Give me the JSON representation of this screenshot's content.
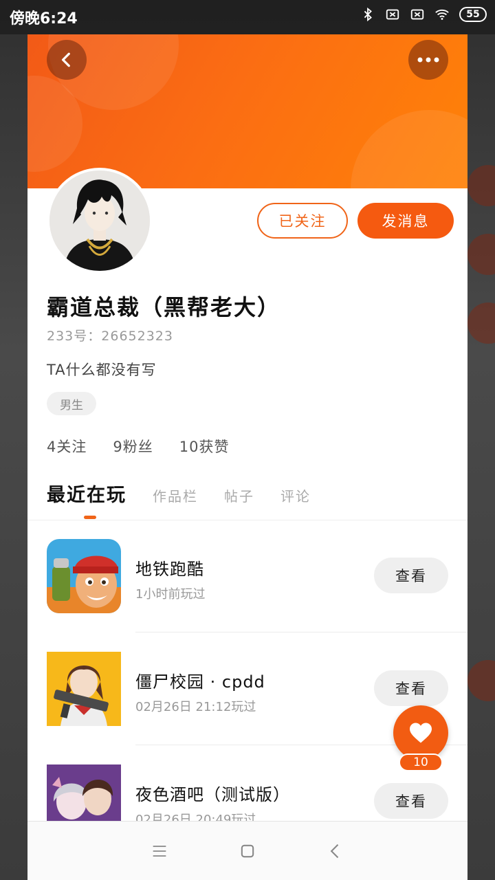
{
  "status_bar": {
    "time": "傍晚6:24",
    "battery": "55"
  },
  "header": {
    "back_icon": "chevron-left-icon",
    "more_icon": "ellipsis-icon"
  },
  "profile": {
    "username": "霸道总裁（黑帮老大）",
    "uid": "233号：26652323",
    "bio": "TA什么都没有写",
    "gender": "男生",
    "following": "4关注",
    "followers": "9粉丝",
    "likes": "10获赞"
  },
  "actions": {
    "followed_label": "已关注",
    "message_label": "发消息"
  },
  "tabs": [
    {
      "label": "最近在玩"
    },
    {
      "label": "作品栏"
    },
    {
      "label": "帖子"
    },
    {
      "label": "评论"
    }
  ],
  "games": [
    {
      "title": "地铁跑酷",
      "subtitle": "1小时前玩过",
      "button": "查看"
    },
    {
      "title": "僵尸校园 · cpdd",
      "subtitle": "02月26日 21:12玩过",
      "button": "查看"
    },
    {
      "title": "夜色酒吧（测试版）",
      "subtitle": "02月26日 20:49玩过",
      "button": "查看"
    }
  ],
  "like_fab": {
    "count": "10"
  },
  "colors": {
    "accent": "#f55a10",
    "banner_start": "#f25a17",
    "banner_end": "#ff8208"
  }
}
